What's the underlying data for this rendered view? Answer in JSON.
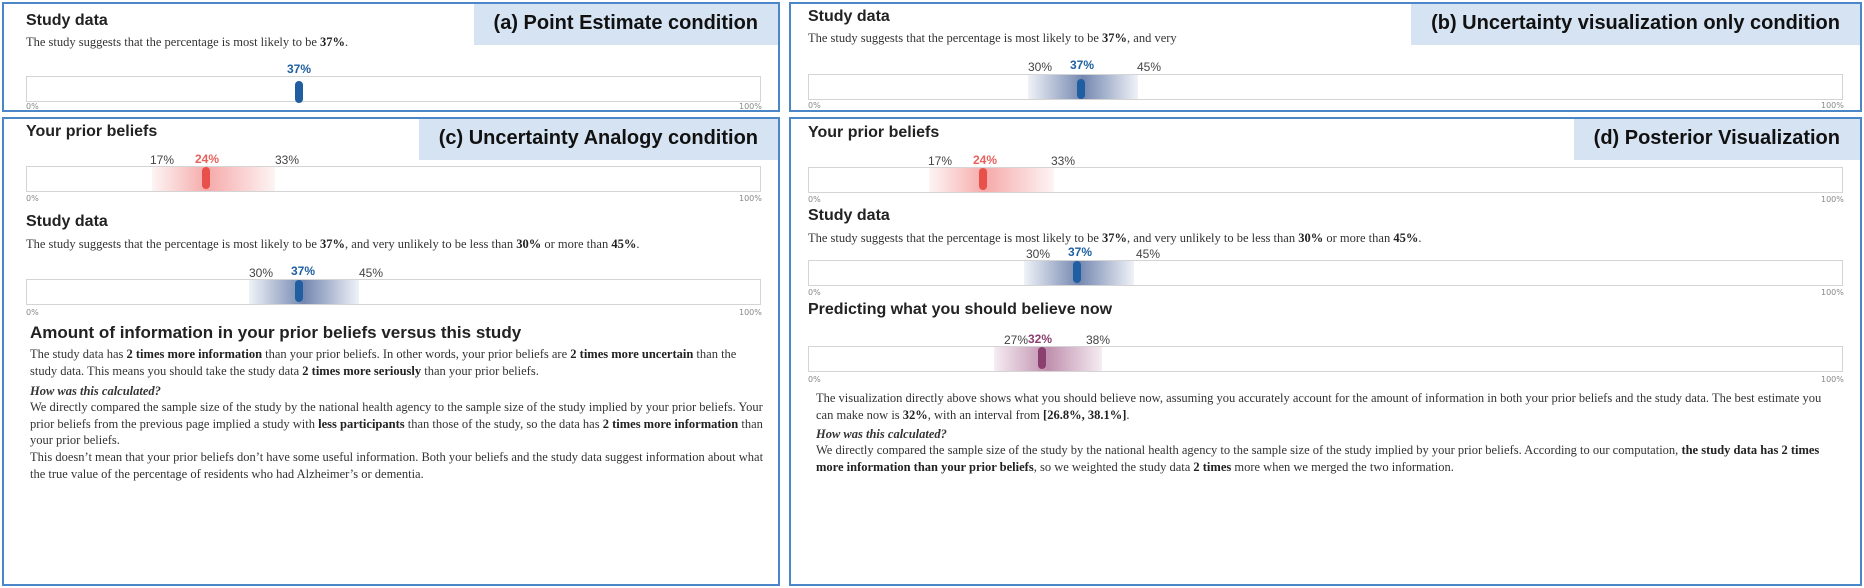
{
  "panel_a": {
    "condition": "(a) Point Estimate condition",
    "study_title": "Study data",
    "study_text_pre": "The study suggests that the percentage is most likely to be ",
    "study_text_value": "37%",
    "study_text_post": ".",
    "estimate": "37%",
    "axis_min": "0%",
    "axis_max": "100%",
    "estimate_value": 37
  },
  "panel_b": {
    "condition": "(b) Uncertainty visualization only condition",
    "study_title": "Study data",
    "study_text_pre": "The study suggests that the percentage is most likely to be ",
    "study_text_value": "37%",
    "study_text_post": ", and very",
    "lower": "30%",
    "estimate": "37%",
    "upper": "45%",
    "axis_min": "0%",
    "axis_max": "100%"
  },
  "panel_c": {
    "condition": "(c) Uncertainty Analogy condition",
    "prior_title": "Your prior beliefs",
    "prior_lower": "17%",
    "prior_estimate": "24%",
    "prior_upper": "33%",
    "axis_min": "0%",
    "axis_max": "100%",
    "study_title": "Study data",
    "study_text_1": "The study suggests that the percentage is most likely to be ",
    "study_text_v1": "37%",
    "study_text_2": ", and very unlikely to be less than ",
    "study_text_v2": "30%",
    "study_text_3": " or more than ",
    "study_text_v3": "45%",
    "study_text_4": ".",
    "study_lower": "30%",
    "study_estimate": "37%",
    "study_upper": "45%",
    "info_title": "Amount of information in your prior beliefs versus this study",
    "info_p1_a": "The study data has ",
    "info_p1_b": "2 times more information",
    "info_p1_c": " than your prior beliefs. In other words, your prior beliefs are ",
    "info_p1_d": "2 times more uncertain",
    "info_p1_e": " than the study data. This means you should take the study data ",
    "info_p1_f": "2 times more seriously",
    "info_p1_g": " than your prior beliefs.",
    "how_title": "How was this calculated?",
    "how_p1_a": "We directly compared the sample size of the study by the national health agency to the sample size of the study implied by your prior beliefs. Your prior beliefs from the previous page implied a study with ",
    "how_p1_b": "less participants",
    "how_p1_c": " than those of the study, so the data has ",
    "how_p1_d": "2 times more information",
    "how_p1_e": " than your prior beliefs.",
    "how_p2": "This doesn’t mean that your prior beliefs don’t have some useful information. Both your beliefs and the study data suggest information about what the true value of the percentage of residents who had Alzheimer’s or dementia."
  },
  "panel_d": {
    "condition": "(d) Posterior Visualization",
    "prior_title": "Your prior beliefs",
    "prior_lower": "17%",
    "prior_estimate": "24%",
    "prior_upper": "33%",
    "axis_min": "0%",
    "axis_max": "100%",
    "study_title": "Study data",
    "study_text_1": "The study suggests that the percentage is most likely to be ",
    "study_text_v1": "37%",
    "study_text_2": ", and very unlikely to be less than ",
    "study_text_v2": "30%",
    "study_text_3": " or more than ",
    "study_text_v3": "45%",
    "study_text_4": ".",
    "study_lower": "30%",
    "study_estimate": "37%",
    "study_upper": "45%",
    "post_title": "Predicting what you should believe now",
    "post_lower": "27%",
    "post_estimate": "32%",
    "post_upper": "38%",
    "post_text_a": "The visualization directly above shows what you should believe now, assuming you accurately account for the amount of information in both your prior beliefs and the study data. The best estimate you can make now is ",
    "post_text_b": "32%",
    "post_text_c": ", with an interval from ",
    "post_text_d": "[26.8%, 38.1%]",
    "post_text_e": ".",
    "how_title": "How was this calculated?",
    "how_a": "We directly compared the sample size of the study by the national health agency to the sample size of the study implied by your prior beliefs. According to our computation, ",
    "how_b": "the study data has 2 times more information than your prior beliefs",
    "how_c": ", so we weighted the study data ",
    "how_d": "2 times",
    "how_e": " more when we merged the two information."
  },
  "colors": {
    "panel_border": "#4a86c8",
    "label_bg": "#d6e3f3",
    "study_blue": "#1f5fa1",
    "prior_red": "#e8504a",
    "posterior_purple": "#8a3f6e"
  }
}
